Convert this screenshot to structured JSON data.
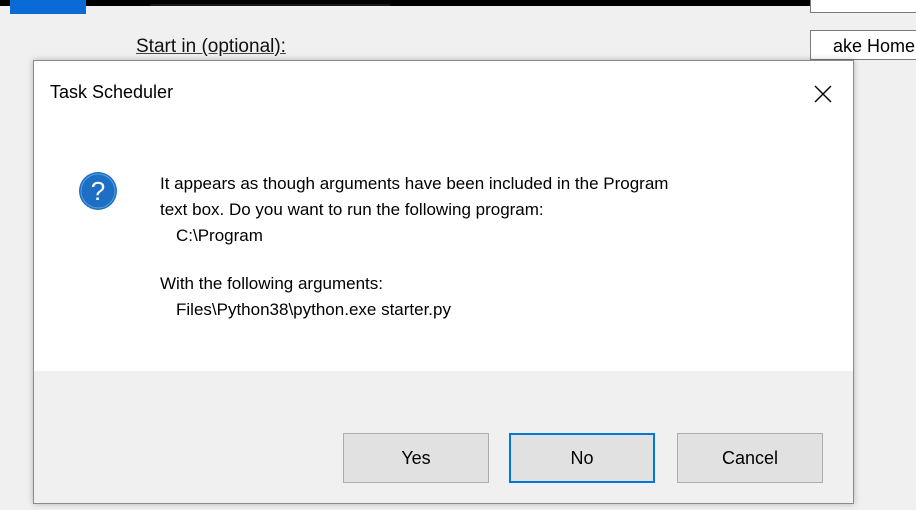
{
  "background": {
    "start_in_label": "Start in (optional):",
    "start_in_value": "ake Home"
  },
  "dialog": {
    "title": "Task Scheduler",
    "close_icon": "close-icon",
    "icon": "question-icon",
    "icon_glyph": "?",
    "message_lines": [
      "It appears as though arguments have been included in the Program",
      "text box. Do you want to run the following program:"
    ],
    "program": "C:\\Program",
    "args_label": "With the following arguments:",
    "args": "Files\\Python38\\python.exe starter.py",
    "buttons": {
      "yes": "Yes",
      "no": "No",
      "cancel": "Cancel"
    },
    "default_button": "No"
  },
  "colors": {
    "accent": "#0078d7",
    "icon_bg": "#1c6fc4",
    "dialog_bg": "#f0f0f0"
  }
}
